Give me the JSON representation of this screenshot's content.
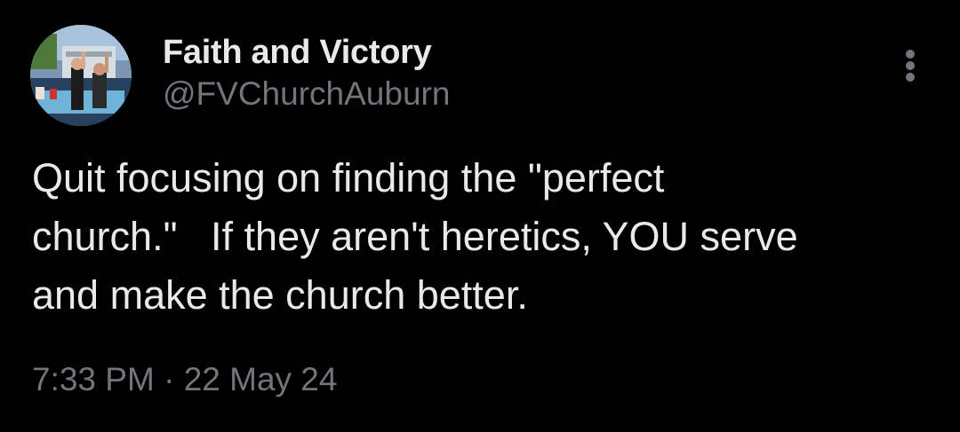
{
  "author": {
    "display_name": "Faith and Victory",
    "handle": "@FVChurchAuburn",
    "avatar_icon": "church-profile-photo"
  },
  "tweet": {
    "text": "Quit focusing on finding the \"perfect\nchurch.\"   If they aren't heretics, YOU serve\nand make the church better.",
    "time": "7:33 PM",
    "separator": " · ",
    "date": "22 May 24"
  },
  "more_icon": "more-vertical-icon",
  "colors": {
    "background": "#000000",
    "primary_text": "#e7e9ea",
    "secondary_text": "#71767b"
  }
}
